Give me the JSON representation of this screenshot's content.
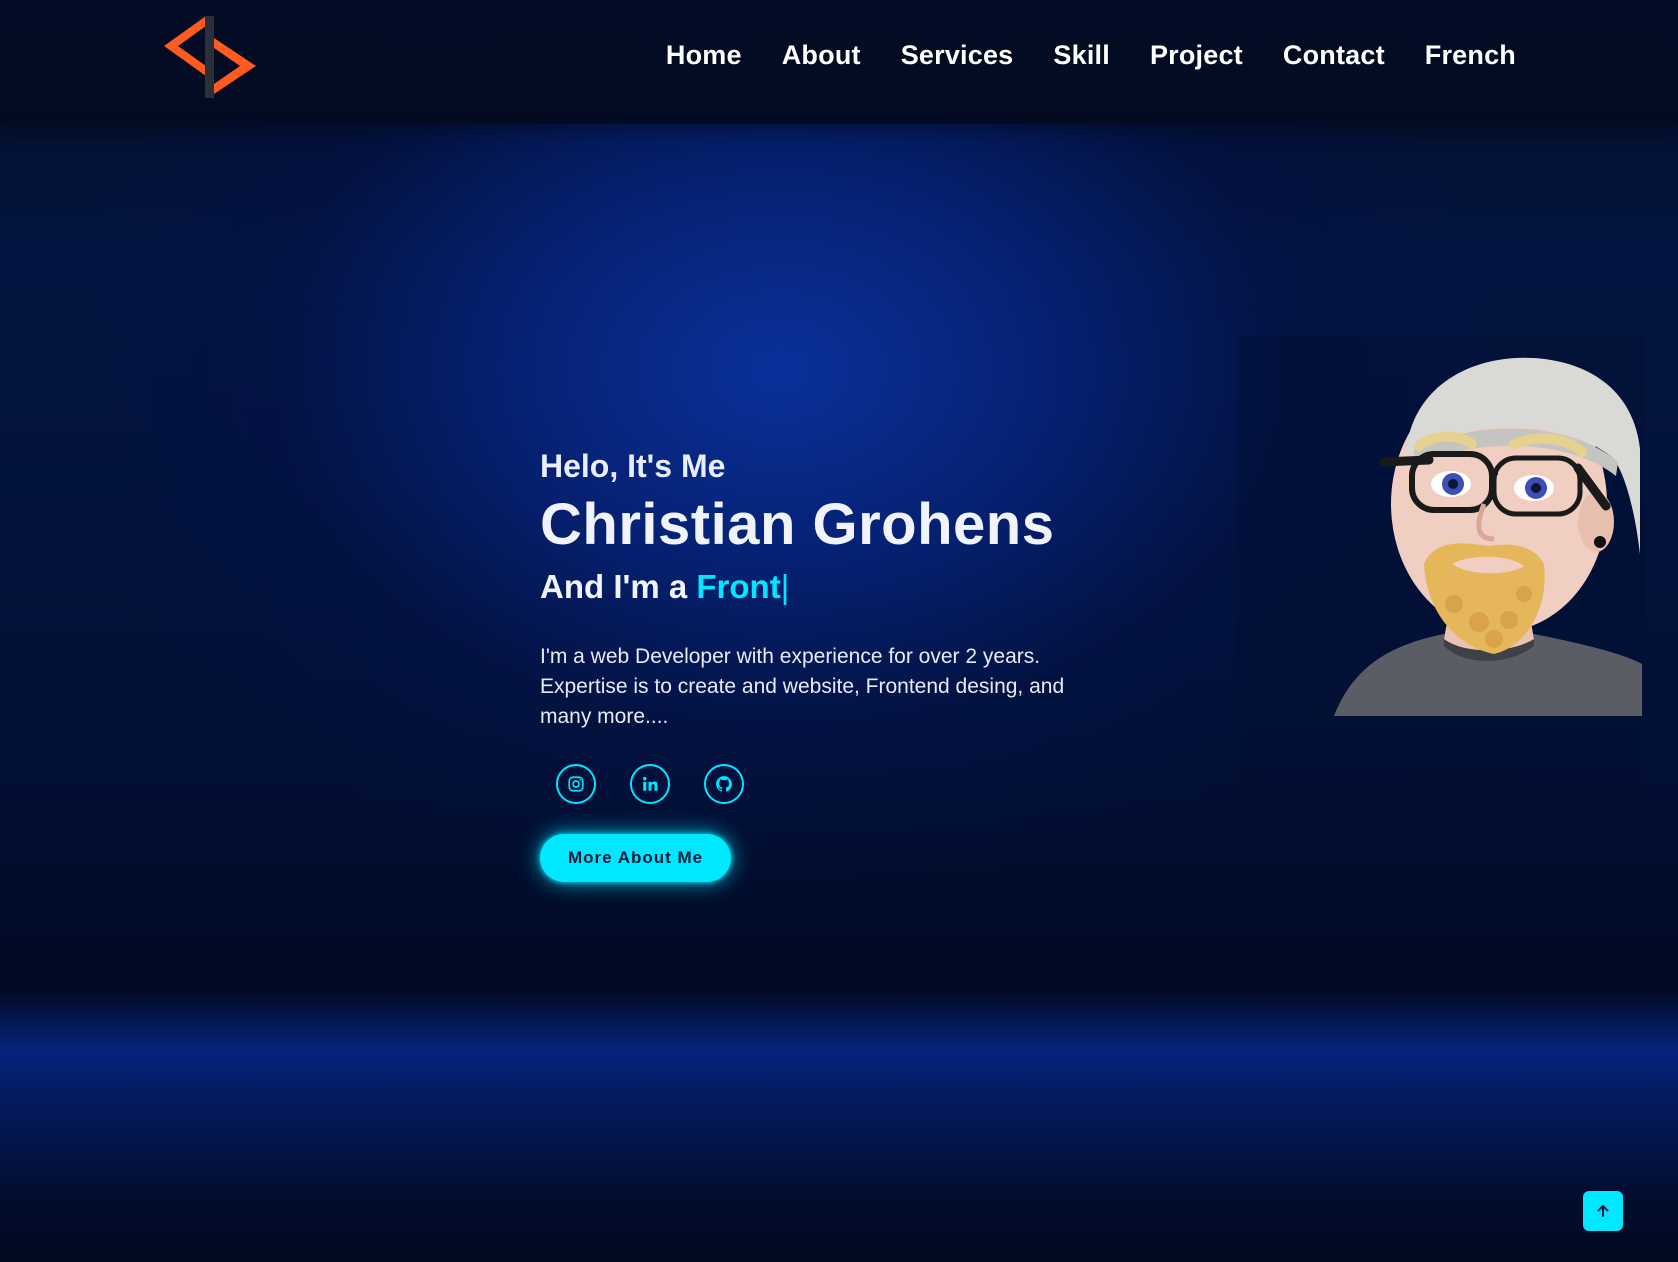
{
  "nav": {
    "items": [
      {
        "label": "Home"
      },
      {
        "label": "About"
      },
      {
        "label": "Services"
      },
      {
        "label": "Skill"
      },
      {
        "label": "Project"
      },
      {
        "label": "Contact"
      },
      {
        "label": "French"
      }
    ]
  },
  "hero": {
    "greeting": "Helo, It's Me",
    "name": "Christian Grohens",
    "role_prefix": "And I'm a",
    "role_typed": "Front",
    "caret": "|",
    "description": "I'm a web Developer with experience for over 2 years. Expertise is to create and website, Frontend desing, and many more....",
    "cta_label": "More About Me"
  },
  "socials": [
    {
      "icon": "instagram-icon"
    },
    {
      "icon": "linkedin-icon"
    },
    {
      "icon": "github-icon"
    }
  ],
  "colors": {
    "accent": "#00e8ff",
    "logo": "#ff5a1f",
    "background": "#020a1f",
    "text": "#ffffff"
  },
  "back_to_top": {
    "icon": "arrow-up-icon"
  }
}
